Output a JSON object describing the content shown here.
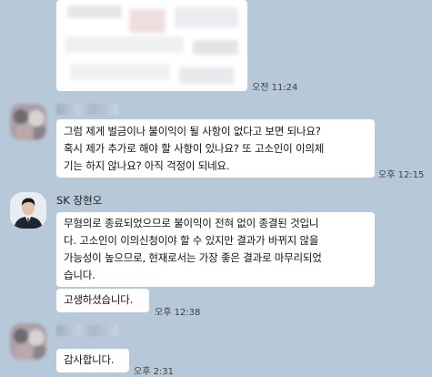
{
  "messages": [
    {
      "time": "오전 11:24"
    },
    {
      "text": "그럼 제게 벌금이나 불이익이 될 사항이 없다고 보면 되나요? 혹시 제가 추가로 해야 할 사항이 있나요? 또 고소인이 이의제기는 하지 않나요? 아직 걱정이 되네요.",
      "time": "오후 12:15"
    },
    {
      "sender": "SK 장현오",
      "text": "무혐의로 종료되었으므로 불이익이 전혀 없이 종결된 것입니다. 고소인이 이의신청이야 할 수 있지만 결과가 바뀌지 않을 가능성이 높으므로, 현재로서는 가장 좋은 결과로 마무리되었습니다."
    },
    {
      "text": "고생하셨습니다.",
      "time": "오후 12:38"
    },
    {
      "text": "감사합니다.",
      "time": "오후 2:31"
    }
  ],
  "lines": {
    "m2": [
      "그럼 제게 벌금이나 불이익이 될 사항이 없다고 보면 되나요?",
      "혹시 제가 추가로 해야 할 사항이 있나요? 또 고소인이 이의제",
      "기는 하지 않나요? 아직 걱정이 되네요."
    ],
    "m3": [
      "무혐의로 종료되었으므로 불이익이 전혀 없이 종결된 것입니",
      "다. 고소인이 이의신청이야 할 수 있지만 결과가 바뀌지 않을",
      "가능성이 높으므로, 현재로서는 가장 좋은 결과로 마무리되었",
      "습니다."
    ]
  },
  "icons": {
    "avatar": "person-avatar-icon"
  }
}
